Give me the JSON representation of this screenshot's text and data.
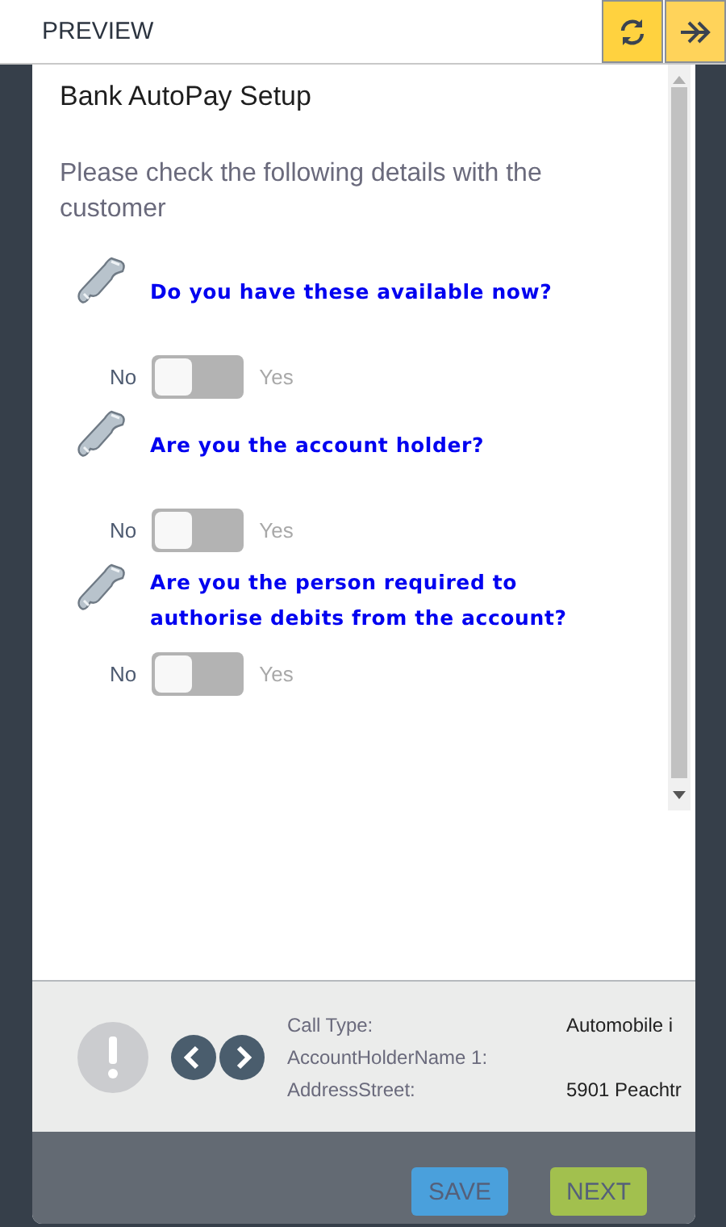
{
  "header": {
    "title": "PREVIEW",
    "buttons": [
      {
        "kind": "refresh"
      },
      {
        "kind": "forward"
      }
    ]
  },
  "form": {
    "title": "Bank AutoPay Setup",
    "intro": "Please check the following details with the customer",
    "questions": [
      {
        "text": "Do you have these available now?",
        "off_label": "No",
        "on_label": "Yes",
        "on": false
      },
      {
        "text": "Are you the account holder?",
        "off_label": "No",
        "on_label": "Yes",
        "on": false
      },
      {
        "text": "Are you the person required to authorise debits from the account?",
        "off_label": "No",
        "on_label": "Yes",
        "on": false
      }
    ]
  },
  "info": {
    "fields": [
      {
        "label": "Call Type:",
        "value": "Automobile i"
      },
      {
        "label": "AccountHolderName 1:"
      },
      {
        "label": "AddressStreet:",
        "value": "5901 Peachtr"
      }
    ]
  },
  "footer": {
    "buttons": [
      {
        "label": "SAVE",
        "kind": "save"
      },
      {
        "label": "NEXT",
        "kind": "next"
      }
    ]
  }
}
